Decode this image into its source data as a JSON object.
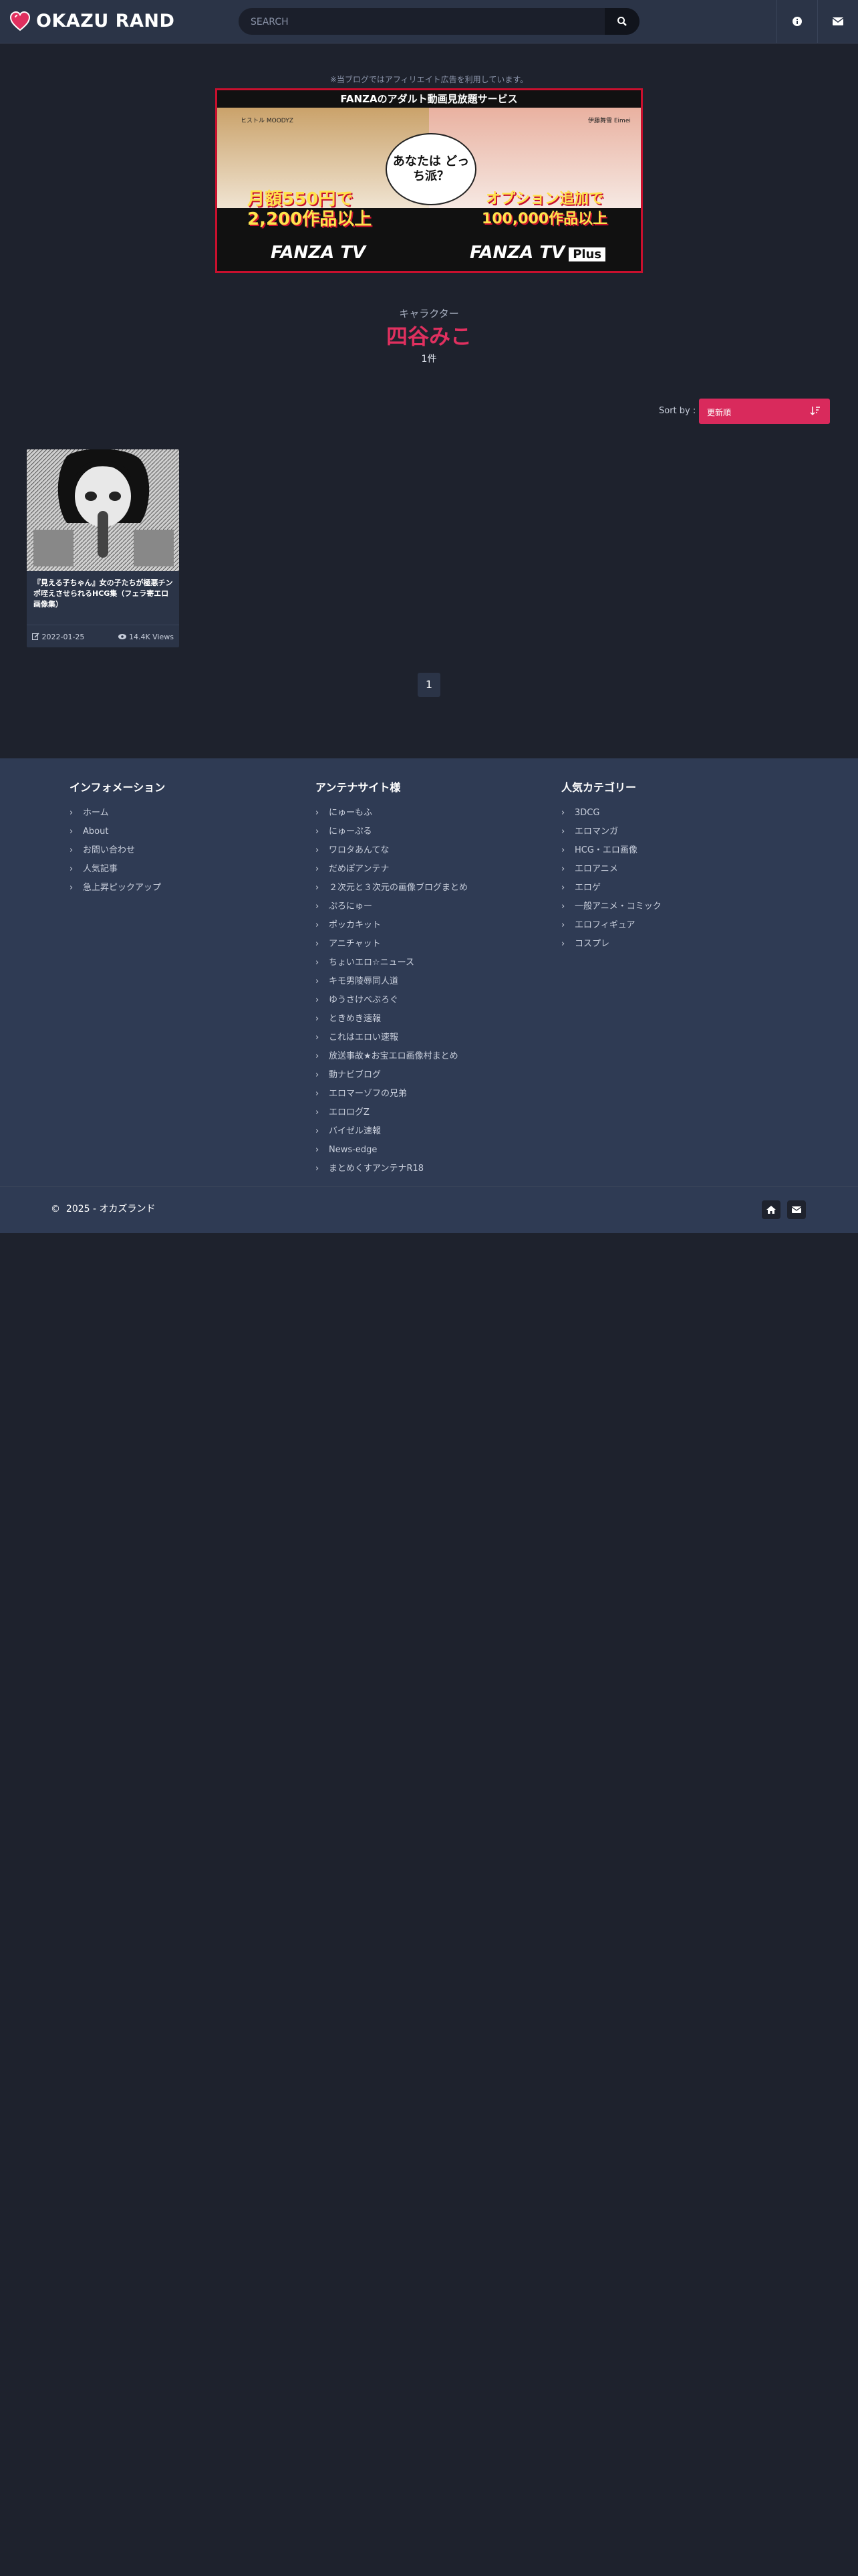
{
  "header": {
    "logo_text": "OKAZU RAND",
    "search_placeholder": "SEARCH",
    "icons": [
      "heart-logo-icon",
      "search-icon",
      "info-icon",
      "envelope-icon"
    ]
  },
  "ad": {
    "disclaimer": "※当ブログではアフィリエイト広告を利用しています。",
    "banner_title": "FANZAのアダルト動画見放題サービス",
    "caption_left": "ヒストル MOODYZ",
    "caption_right": "伊藤舞雪 Eimei",
    "bubble": "あなたは どっち派？",
    "promo_left": "月額550円で 2,200作品以上",
    "promo_right": "オプション追加で 100,000作品以上",
    "brand_left": "FANZA TV",
    "brand_right": "FANZA TV",
    "brand_right_tag": "Plus"
  },
  "category": {
    "label": "キャラクター",
    "name": "四谷みこ",
    "count": "1件"
  },
  "sort": {
    "label": "Sort by :",
    "selected": "更新順"
  },
  "posts": [
    {
      "title": "『見える子ちゃん』女の子たちが極悪チンポ咥えさせられるHCG集（フェラ寄エロ画像集）",
      "date": "2022-01-25",
      "views": "14.4K Views"
    }
  ],
  "pagination": {
    "current": "1"
  },
  "footer": {
    "columns": [
      {
        "title": "インフォメーション",
        "items": [
          "ホーム",
          "About",
          "お問い合わせ",
          "人気記事",
          "急上昇ピックアップ"
        ]
      },
      {
        "title": "アンテナサイト様",
        "items": [
          "にゅーもふ",
          "にゅーぷる",
          "ワロタあんてな",
          "だめぽアンテナ",
          "２次元と３次元の画像ブログまとめ",
          "ぷろにゅー",
          "ポッカキット",
          "アニチャット",
          "ちょいエロ☆ニュース",
          "キモ男陵辱同人道",
          "ゆうさけべぶろぐ",
          "ときめき速報",
          "これはエロい速報",
          "放送事故★お宝エロ画像村まとめ",
          "動ナビブログ",
          "エロマーゾフの兄弟",
          "エロログZ",
          "バイゼル速報",
          "News-edge",
          "まとめくすアンテナR18"
        ]
      },
      {
        "title": "人気カテゴリー",
        "items": [
          "3DCG",
          "エロマンガ",
          "HCG・エロ画像",
          "エロアニメ",
          "エロゲ",
          "一般アニメ・コミック",
          "エロフィギュア",
          "コスプレ"
        ]
      }
    ],
    "copyright": "2025 - オカズランド",
    "copyright_symbol": "©"
  },
  "colors": {
    "background": "#1e222d",
    "header": "#2b3447",
    "accent": "#e0305f",
    "footer": "#2f3b54"
  }
}
